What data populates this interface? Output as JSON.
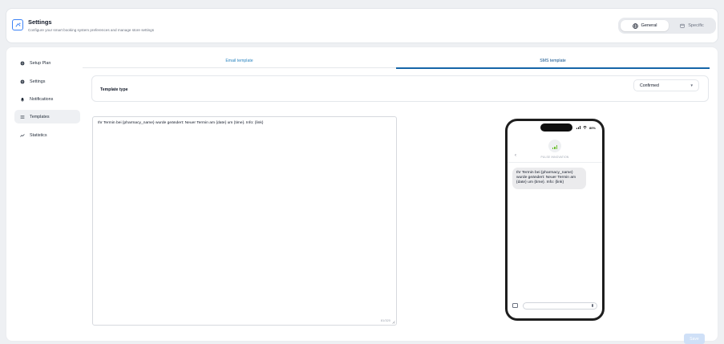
{
  "header": {
    "title": "Settings",
    "subtitle": "Configure your smart booking system preferences and manage store settings",
    "segments": [
      {
        "label": "General",
        "icon": "globe-icon",
        "active": true
      },
      {
        "label": "Specific",
        "icon": "calendar-icon",
        "active": false
      }
    ]
  },
  "sidebar": {
    "items": [
      {
        "label": "Setup Plan",
        "icon": "gear-icon"
      },
      {
        "label": "Settings",
        "icon": "gear-icon"
      },
      {
        "label": "Notifications",
        "icon": "bell-icon"
      },
      {
        "label": "Templates",
        "icon": "list-icon",
        "active": true
      },
      {
        "label": "Statistics",
        "icon": "trend-line-icon"
      }
    ]
  },
  "tabs": [
    {
      "label": "Email template",
      "active": false
    },
    {
      "label": "SMS template",
      "active": true
    }
  ],
  "template_type": {
    "label": "Template type",
    "selected": "Confirmed"
  },
  "editor": {
    "value": "Ihr Termin bei {pharmacy_name} wurde geändert: Neuer Termin am {date} um {time}. Info: {link}",
    "counter": "81/320"
  },
  "phone": {
    "status": "80%",
    "sender": "PULSE INNOVATION",
    "message": "Ihr Termin bei {pharmacy_name} wurde geändert: Neuer Termin am {date} um {time}. Info: {link}"
  },
  "actions": {
    "save_label": "Save"
  },
  "colors": {
    "accent": "#1565a8",
    "tab_inactive": "#2e86c1",
    "logo_green": "#6bbf2f",
    "save_disabled": "#cfe0f7"
  }
}
